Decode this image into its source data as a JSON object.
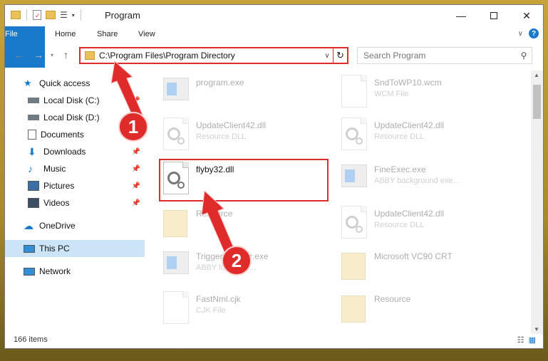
{
  "window": {
    "title": "Program"
  },
  "ribbon": {
    "tabs": [
      "File",
      "Home",
      "Share",
      "View"
    ]
  },
  "address": {
    "path": "C:\\Program Files\\Program Directory"
  },
  "search": {
    "placeholder": "Search Program"
  },
  "sidebar": {
    "items": [
      {
        "label": "Quick access",
        "icon": "star-icon",
        "pinned": false
      },
      {
        "label": "Local Disk (C:)",
        "icon": "drive-icon",
        "pinned": true
      },
      {
        "label": "Local Disk (D:)",
        "icon": "drive-icon",
        "pinned": true
      },
      {
        "label": "Documents",
        "icon": "documents-icon",
        "pinned": true
      },
      {
        "label": "Downloads",
        "icon": "download-icon",
        "pinned": true
      },
      {
        "label": "Music",
        "icon": "music-icon",
        "pinned": true
      },
      {
        "label": "Pictures",
        "icon": "pictures-icon",
        "pinned": true
      },
      {
        "label": "Videos",
        "icon": "videos-icon",
        "pinned": true
      },
      {
        "label": "OneDrive",
        "icon": "cloud-icon",
        "pinned": false
      },
      {
        "label": "This PC",
        "icon": "computer-icon",
        "pinned": false,
        "selected": true
      },
      {
        "label": "Network",
        "icon": "network-icon",
        "pinned": false
      }
    ]
  },
  "files": [
    {
      "name": "program.exe",
      "sub": "",
      "kind": "exe"
    },
    {
      "name": "SndToWP10.wcm",
      "sub": "WCM File",
      "kind": "doc"
    },
    {
      "name": "UpdateClient42.dll",
      "sub": "Resource DLL",
      "kind": "dll"
    },
    {
      "name": "UpdateClient42.dll",
      "sub": "Resource DLL",
      "kind": "dll"
    },
    {
      "name": "flyby32.dll",
      "sub": "",
      "kind": "dll"
    },
    {
      "name": "FineExec.exe",
      "sub": "ABBY background exe...",
      "kind": "exe"
    },
    {
      "name": "Resource",
      "sub": "",
      "kind": "folder"
    },
    {
      "name": "UpdateClient42.dll",
      "sub": "Resource DLL",
      "kind": "dll"
    },
    {
      "name": "TriggerInstaller.exe",
      "sub": "ABBY loader to...",
      "kind": "exe"
    },
    {
      "name": "Microsoft VC90 CRT",
      "sub": "",
      "kind": "folder"
    },
    {
      "name": "FastNml.cjk",
      "sub": "CJK File",
      "kind": "doc"
    },
    {
      "name": "Resource",
      "sub": "",
      "kind": "folder"
    }
  ],
  "status": {
    "count": "166 items"
  },
  "annotations": {
    "badge1": "1",
    "badge2": "2"
  },
  "colors": {
    "accent": "#1979ca",
    "annotation": "#e02b2b",
    "selection": "#cce4f7"
  }
}
